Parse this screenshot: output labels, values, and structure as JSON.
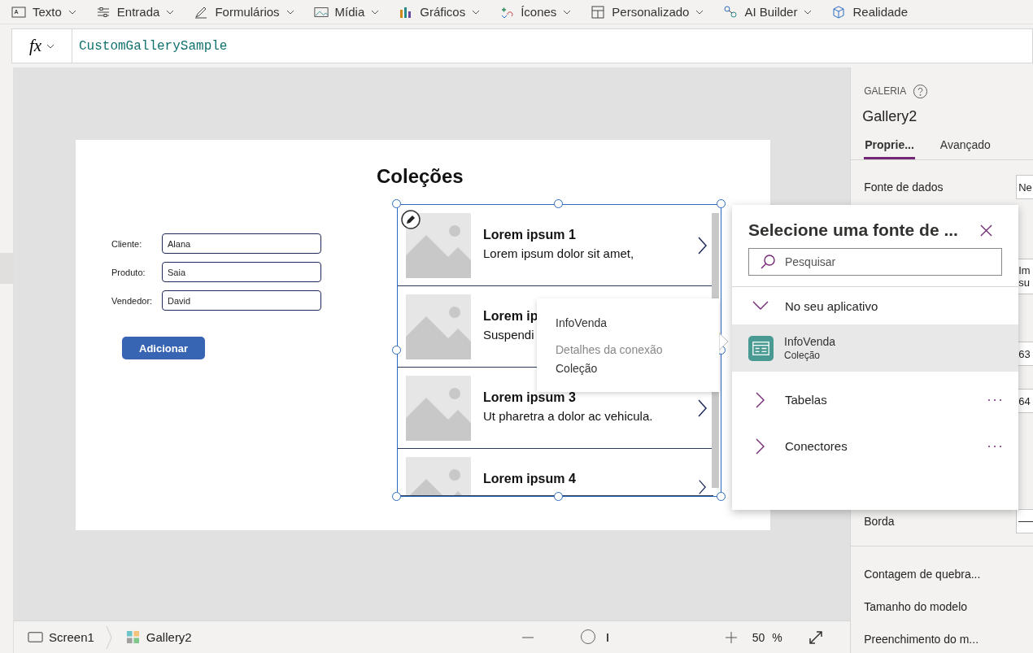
{
  "ribbon": [
    {
      "label": "Texto"
    },
    {
      "label": "Entrada"
    },
    {
      "label": "Formulários"
    },
    {
      "label": "Mídia"
    },
    {
      "label": "Gráficos"
    },
    {
      "label": "Ícones"
    },
    {
      "label": "Personalizado"
    },
    {
      "label": "AI Builder"
    },
    {
      "label": "Realidade"
    }
  ],
  "formula_bar": {
    "fx": "fx",
    "value": "CustomGallerySample"
  },
  "screen": {
    "title": "Coleções",
    "form": [
      {
        "label": "Cliente:",
        "value": "Alana"
      },
      {
        "label": "Produto:",
        "value": "Saia"
      },
      {
        "label": "Vendedor:",
        "value": "David"
      }
    ],
    "button": "Adicionar",
    "gallery": [
      {
        "title": "Lorem ipsum 1",
        "subtitle": "Lorem ipsum dolor sit amet,",
        "chevron": true
      },
      {
        "title": "Lorem ip",
        "subtitle": "Suspendi",
        "chevron": false
      },
      {
        "title": "Lorem ipsum 3",
        "subtitle": "Ut pharetra a dolor ac vehicula.",
        "chevron": true
      },
      {
        "title": "Lorem ipsum 4",
        "chevron": true
      }
    ]
  },
  "tooltip": {
    "title": "InfoVenda",
    "section": "Detalhes da conexão",
    "type": "Coleção"
  },
  "data_source_panel": {
    "title": "Selecione uma fonte de ...",
    "search": {
      "placeholder": "Pesquisar"
    },
    "groups": [
      {
        "label": "No seu aplicativo",
        "expanded": true,
        "more": false,
        "items": [
          {
            "name": "InfoVenda",
            "type": "Coleção",
            "selected": true
          }
        ]
      },
      {
        "label": "Tabelas",
        "expanded": false,
        "more": true
      },
      {
        "label": "Conectores",
        "expanded": false,
        "more": true
      }
    ]
  },
  "properties": {
    "category": "GALERIA",
    "name": "Gallery2",
    "tabs": [
      {
        "label": "Proprie...",
        "selected": true
      },
      {
        "label": "Avançado",
        "selected": false
      }
    ],
    "rows": [
      {
        "kind": "field",
        "label": "Fonte de dados",
        "lines": [
          "Ne"
        ]
      },
      {
        "kind": "field",
        "lines": [
          "Im",
          "su"
        ]
      },
      {
        "kind": "field",
        "lines": [
          "63"
        ]
      },
      {
        "kind": "field",
        "lines": [
          "64"
        ]
      },
      {
        "kind": "border",
        "label": "Borda"
      }
    ],
    "links": [
      "Contagem de quebra...",
      "Tamanho do modelo",
      "Preenchimento do m..."
    ]
  },
  "status_bar": {
    "breadcrumb": [
      {
        "label": "Screen1"
      },
      {
        "label": "Gallery2"
      }
    ],
    "zoom": {
      "level": 0.3,
      "value": "50",
      "unit": "%"
    }
  }
}
